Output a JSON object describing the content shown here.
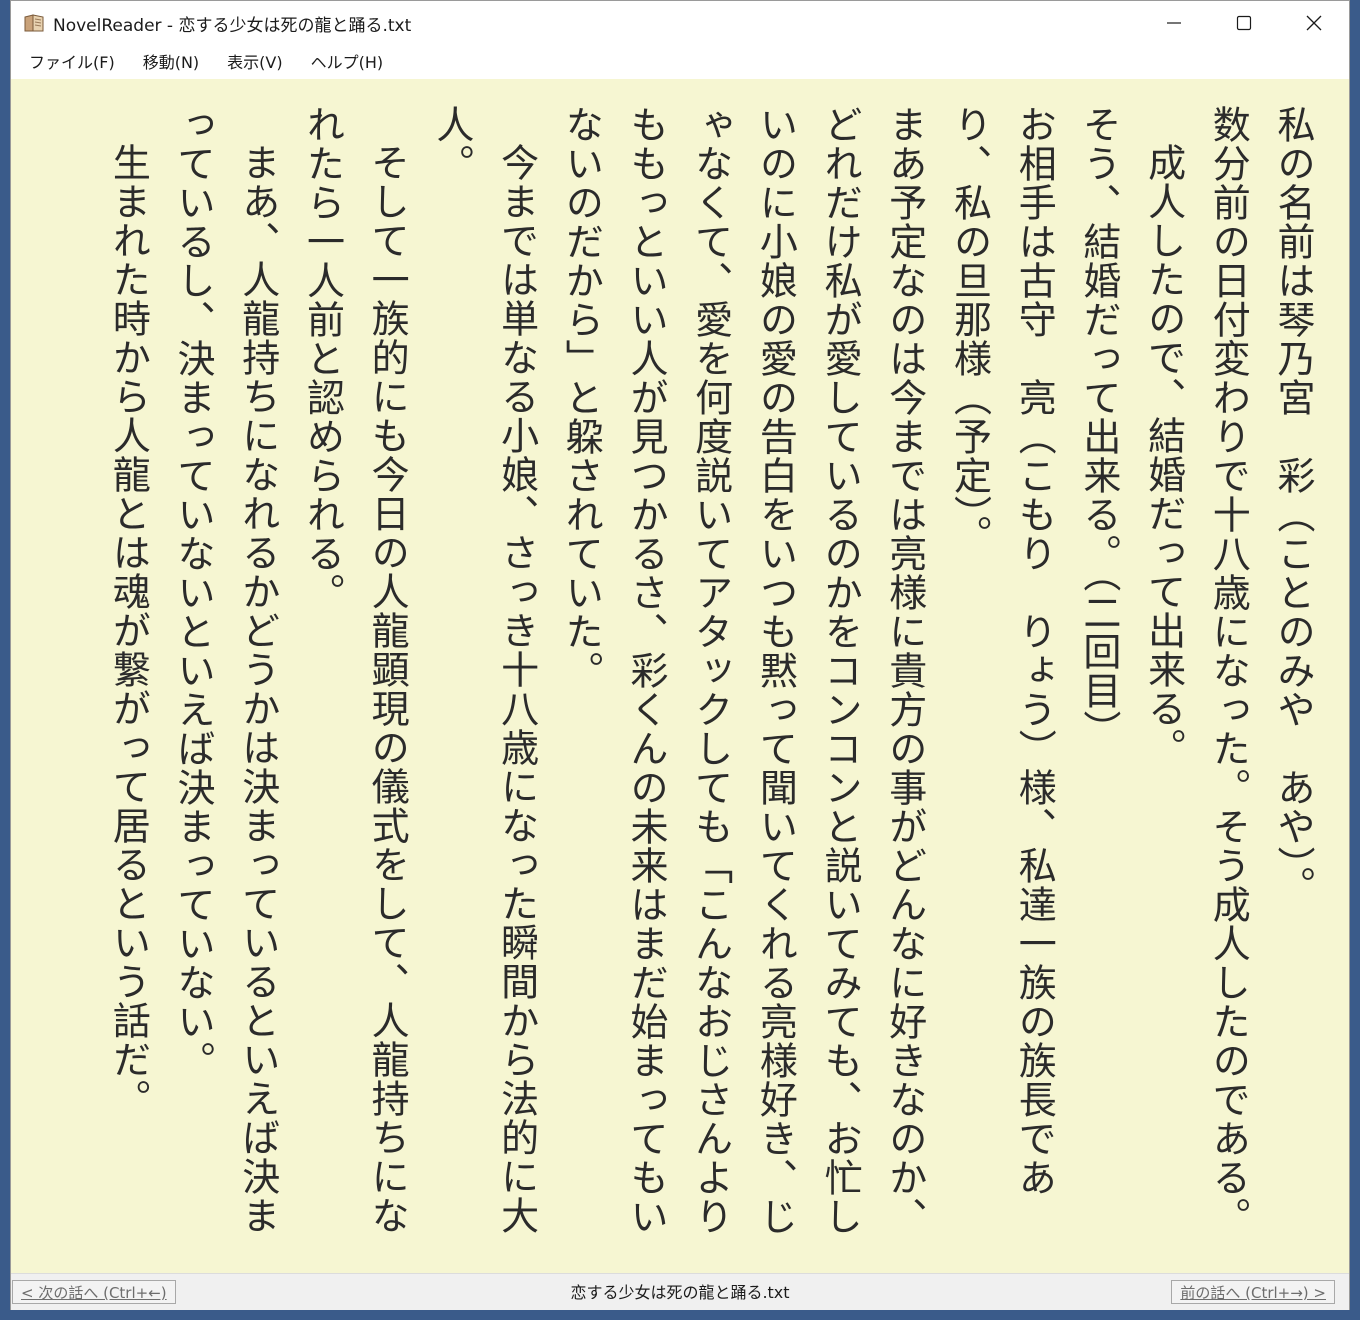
{
  "window": {
    "title": "NovelReader - 恋する少女は死の龍と踊る.txt",
    "icon": "book-icon",
    "controls": [
      "minimize-icon",
      "maximize-icon",
      "close-icon"
    ]
  },
  "menu": {
    "file": "ファイル(F)",
    "move": "移動(N)",
    "view": "表示(V)",
    "help": "ヘルプ(H)"
  },
  "content": {
    "background_color": "#f6f6d2",
    "paragraphs": [
      "私の名前は琴乃宮　彩（ことのみや　あや）。",
      "数分前の日付変わりで十八歳になった。そう成人したのである。",
      "成人したので、結婚だって出来る。",
      "そう、結婚だって出来る。（二回目）",
      "お相手は古守　亮（こもり　りょう）様、私達一族の族長であり、私の旦那様（予定）。",
      "まあ予定なのは今までは亮様に貴方の事がどんなに好きなのか、どれだけ私が愛しているのかをコンコンと説いてみても、お忙しいのに小娘の愛の告白をいつも黙って聞いてくれる亮様好き、じゃなくて、愛を何度説いてアタックしても「こんなおじさんよりももっといい人が見つかるさ、彩くんの未来はまだ始まってもいないのだから」と躱されていた。",
      "今までは単なる小娘、さっき十八歳になった瞬間から法的に大人。",
      "そして一族的にも今日の人龍顕現の儀式をして、人龍持ちになれたら一人前と認められる。",
      "まあ、人龍持ちになれるかどうかは決まっているといえば決まっているし、決まっていないといえば決まっていない。",
      "生まれた時から人龍とは魂が繋がって居るという話だ。"
    ],
    "indented": [
      false,
      false,
      true,
      false,
      false,
      false,
      true,
      true,
      true,
      true
    ]
  },
  "status": {
    "prev_button": "< 次の話へ (Ctrl+←)",
    "filename": "恋する少女は死の龍と踊る.txt",
    "next_button": "前の話へ (Ctrl+→) >"
  }
}
